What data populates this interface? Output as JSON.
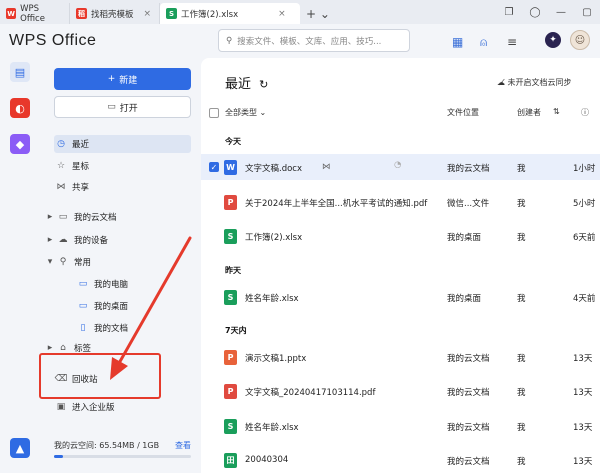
{
  "tabs": [
    {
      "label": "WPS Office",
      "icon": "wps-logo",
      "color": "#e8382b"
    },
    {
      "label": "找稻壳模板",
      "icon": "docer-icon",
      "color": "#e8382b"
    },
    {
      "label": "工作簿(2).xlsx",
      "icon": "sheet-icon",
      "color": "#1a9e5b"
    }
  ],
  "header": {
    "brand": "WPS Office",
    "search_placeholder": "搜索文件、模板、文库、应用、技巧..."
  },
  "nav": {
    "new_label": "新建",
    "open_label": "打开",
    "items": [
      "最近",
      "星标",
      "共享",
      "我的云文档",
      "我的设备",
      "常用",
      "我的电脑",
      "我的桌面",
      "我的文档",
      "标签",
      "回收站",
      "进入企业版"
    ],
    "storage_text": "我的云空间: 65.54MB / 1GB",
    "storage_link": "查看",
    "storage_fraction": 0.064
  },
  "main": {
    "title": "最近",
    "sync_text": "未开启文档云同步",
    "columns": {
      "type": "全部类型",
      "location": "文件位置",
      "owner": "创建者"
    },
    "groups": [
      "今天",
      "昨天",
      "7天内"
    ],
    "rows": [
      {
        "name": "文字文稿.docx",
        "loc": "我的云文档",
        "owner": "我",
        "time": "1小时",
        "kind": "W",
        "color": "#2f6be3"
      },
      {
        "name": "关于2024年上半年全国...机水平考试的通知.pdf",
        "loc": "微信...文件",
        "owner": "我",
        "time": "5小时",
        "kind": "P",
        "color": "#e04a3f"
      },
      {
        "name": "工作簿(2).xlsx",
        "loc": "我的桌面",
        "owner": "我",
        "time": "6天前",
        "kind": "S",
        "color": "#1a9e5b"
      },
      {
        "name": "姓名年龄.xlsx",
        "loc": "我的桌面",
        "owner": "我",
        "time": "4天前",
        "kind": "S",
        "color": "#1a9e5b"
      },
      {
        "name": "演示文稿1.pptx",
        "loc": "我的云文档",
        "owner": "我",
        "time": "13天",
        "kind": "P",
        "color": "#e8623a"
      },
      {
        "name": "文字文稿_20240417103114.pdf",
        "loc": "我的云文档",
        "owner": "我",
        "time": "13天",
        "kind": "P",
        "color": "#e04a3f"
      },
      {
        "name": "姓名年龄.xlsx",
        "loc": "我的云文档",
        "owner": "我",
        "time": "13天",
        "kind": "S",
        "color": "#1a9e5b"
      },
      {
        "name": "20040304",
        "loc": "我的云文档",
        "owner": "我",
        "time": "13天",
        "kind": "田",
        "color": "#1a9e5b"
      }
    ]
  }
}
